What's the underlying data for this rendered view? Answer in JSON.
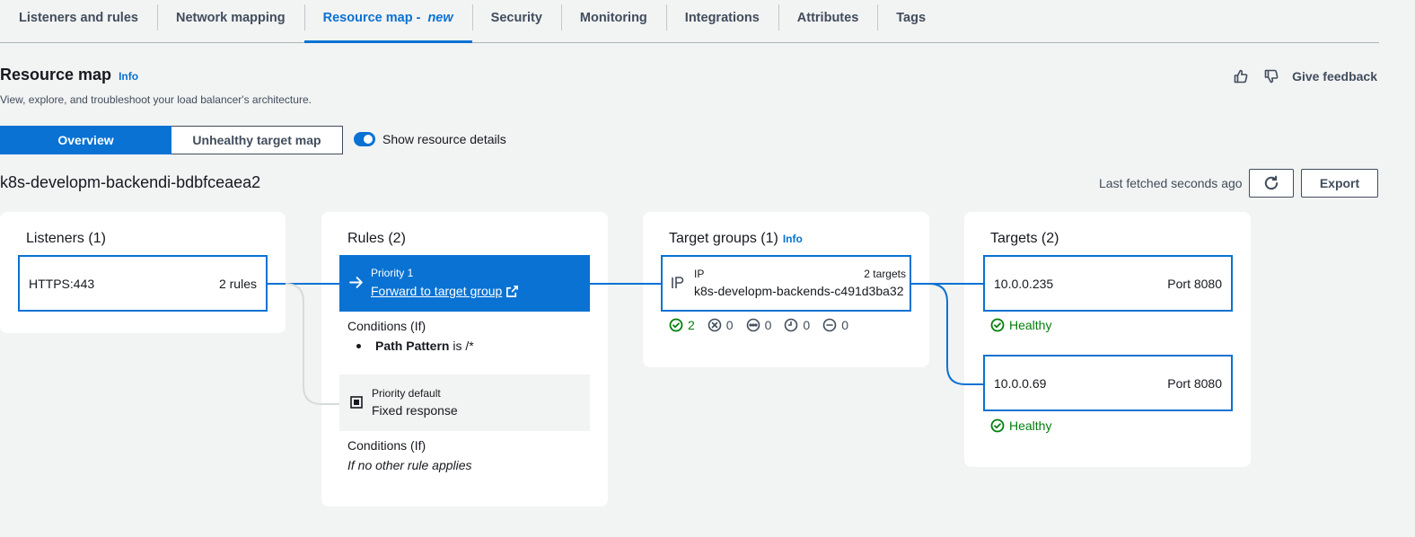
{
  "tabs": [
    {
      "label": "Listeners and rules"
    },
    {
      "label": "Network mapping"
    },
    {
      "label": "Resource map - ",
      "suffix": "new",
      "active": true
    },
    {
      "label": "Security"
    },
    {
      "label": "Monitoring"
    },
    {
      "label": "Integrations"
    },
    {
      "label": "Attributes"
    },
    {
      "label": "Tags"
    }
  ],
  "header": {
    "title": "Resource map",
    "info": "Info",
    "description": "View, explore, and troubleshoot your load balancer's architecture.",
    "feedback": "Give feedback"
  },
  "view_toggle": {
    "overview": "Overview",
    "unhealthy": "Unhealthy target map"
  },
  "details_toggle": {
    "label": "Show resource details",
    "on": true
  },
  "load_balancer": {
    "name": "k8s-developm-backendi-bdbfceaea2",
    "last_fetched": "Last fetched seconds ago",
    "export": "Export"
  },
  "listeners": {
    "title": "Listeners (1)",
    "items": [
      {
        "protocol": "HTTPS:443",
        "rules": "2 rules"
      }
    ]
  },
  "rules": {
    "title": "Rules (2)",
    "rule1": {
      "priority": "Priority 1",
      "action": "Forward to target group",
      "conditions_label": "Conditions (If)",
      "condition_key": "Path Pattern",
      "condition_rest": " is /*"
    },
    "rule2": {
      "priority": "Priority default",
      "action": "Fixed response",
      "conditions_label": "Conditions (If)",
      "condition_text": "If no other rule applies"
    }
  },
  "target_groups": {
    "title": "Target groups (1)",
    "info": "Info",
    "group": {
      "type": "IP",
      "targets": "2 targets",
      "name": "k8s-developm-backends-c491d3ba32",
      "stats": {
        "healthy": "2",
        "unhealthy": "0",
        "unused": "0",
        "draining": "0",
        "unavailable": "0"
      }
    }
  },
  "targets": {
    "title": "Targets (2)",
    "items": [
      {
        "ip": "10.0.0.235",
        "port": "Port 8080",
        "status": "Healthy"
      },
      {
        "ip": "10.0.0.69",
        "port": "Port 8080",
        "status": "Healthy"
      }
    ]
  },
  "colors": {
    "accent": "#0972d3",
    "healthy": "#037f0c",
    "background": "#f2f3f3"
  }
}
